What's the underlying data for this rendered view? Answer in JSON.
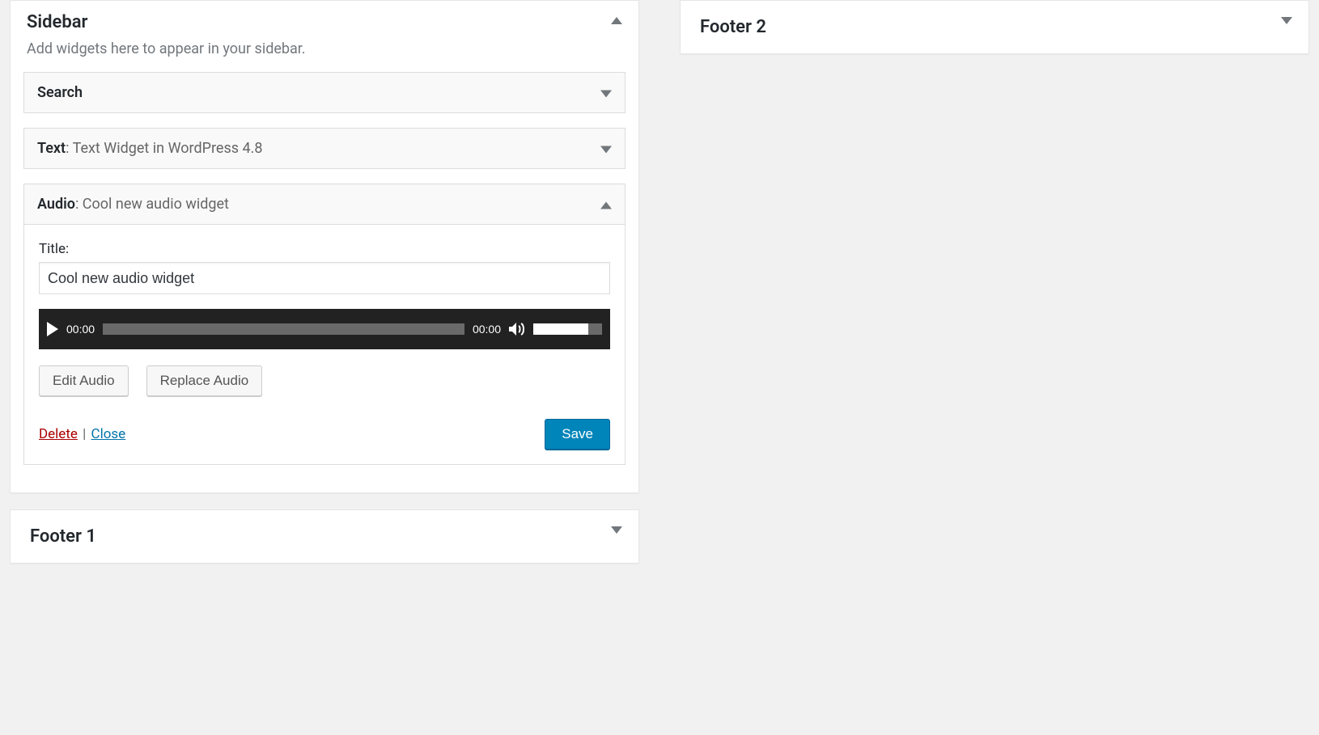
{
  "sidebar": {
    "title": "Sidebar",
    "description": "Add widgets here to appear in your sidebar.",
    "widgets": {
      "search": {
        "name": "Search"
      },
      "text": {
        "name": "Text",
        "subtitle": "Text Widget in WordPress 4.8"
      },
      "audio": {
        "name": "Audio",
        "subtitle": "Cool new audio widget",
        "title_label": "Title:",
        "title_value": "Cool new audio widget",
        "player": {
          "current": "00:00",
          "duration": "00:00"
        },
        "edit_label": "Edit Audio",
        "replace_label": "Replace Audio",
        "delete_label": "Delete",
        "close_label": "Close",
        "save_label": "Save"
      }
    }
  },
  "footer1": {
    "title": "Footer 1"
  },
  "footer2": {
    "title": "Footer 2"
  }
}
